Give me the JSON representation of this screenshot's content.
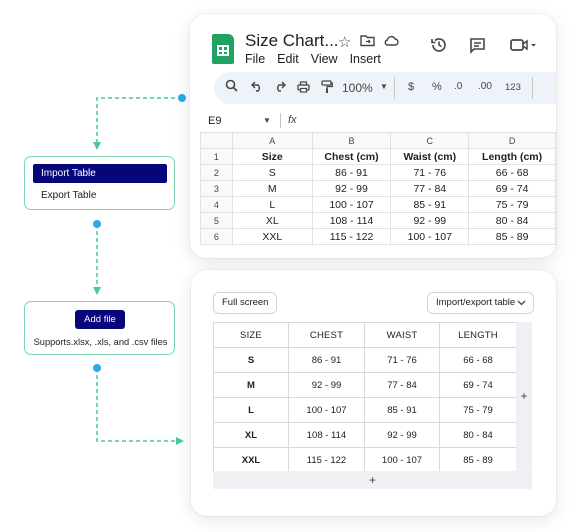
{
  "sheets": {
    "title": "Size Chart...",
    "menu": [
      "File",
      "Edit",
      "View",
      "Insert"
    ],
    "toolbar": {
      "zoom": "100%",
      "currency": "$",
      "percent": "%",
      "dec_decrease": ".0",
      "dec_increase": ".00",
      "number_format": "123"
    },
    "name_box": "E9",
    "fx_label": "fx",
    "col_headers": [
      "A",
      "B",
      "C",
      "D"
    ],
    "rows": [
      {
        "num": "1",
        "cells": [
          "Size",
          "Chest (cm)",
          "Waist (cm)",
          "Length (cm)"
        ]
      },
      {
        "num": "2",
        "cells": [
          "S",
          "86 - 91",
          "71 - 76",
          "66 - 68"
        ]
      },
      {
        "num": "3",
        "cells": [
          "M",
          "92 - 99",
          "77 - 84",
          "69 - 74"
        ]
      },
      {
        "num": "4",
        "cells": [
          "L",
          "100 - 107",
          "85 - 91",
          "75 - 79"
        ]
      },
      {
        "num": "5",
        "cells": [
          "XL",
          "108 - 114",
          "92 - 99",
          "80 - 84"
        ]
      },
      {
        "num": "6",
        "cells": [
          "XXL",
          "115 - 122",
          "100 - 107",
          "85 - 89"
        ]
      }
    ]
  },
  "import_menu": {
    "import_label": "Import Table",
    "export_label": "Export Table"
  },
  "add_file": {
    "button_label": "Add file",
    "supports_text": "Supports.xlsx, .xls, and .csv files"
  },
  "editor": {
    "fullscreen_label": "Full screen",
    "import_export_label": "Import/export table",
    "headers": [
      "SIZE",
      "CHEST",
      "WAIST",
      "LENGTH"
    ],
    "rows": [
      [
        "S",
        "86 - 91",
        "71 - 76",
        "66 - 68"
      ],
      [
        "M",
        "92 - 99",
        "77 - 84",
        "69 - 74"
      ],
      [
        "L",
        "100 - 107",
        "85 - 91",
        "75 - 79"
      ],
      [
        "XL",
        "108 - 114",
        "92 - 99",
        "80 - 84"
      ],
      [
        "XXL",
        "115 - 122",
        "100 - 107",
        "85 - 89"
      ]
    ],
    "add_column_symbol": "+",
    "add_row_symbol": "+"
  },
  "colors": {
    "accent_navy": "#06057a",
    "connector": "#49c7a8",
    "dot": "#29a9e6",
    "sheets_green": "#1ea362"
  }
}
